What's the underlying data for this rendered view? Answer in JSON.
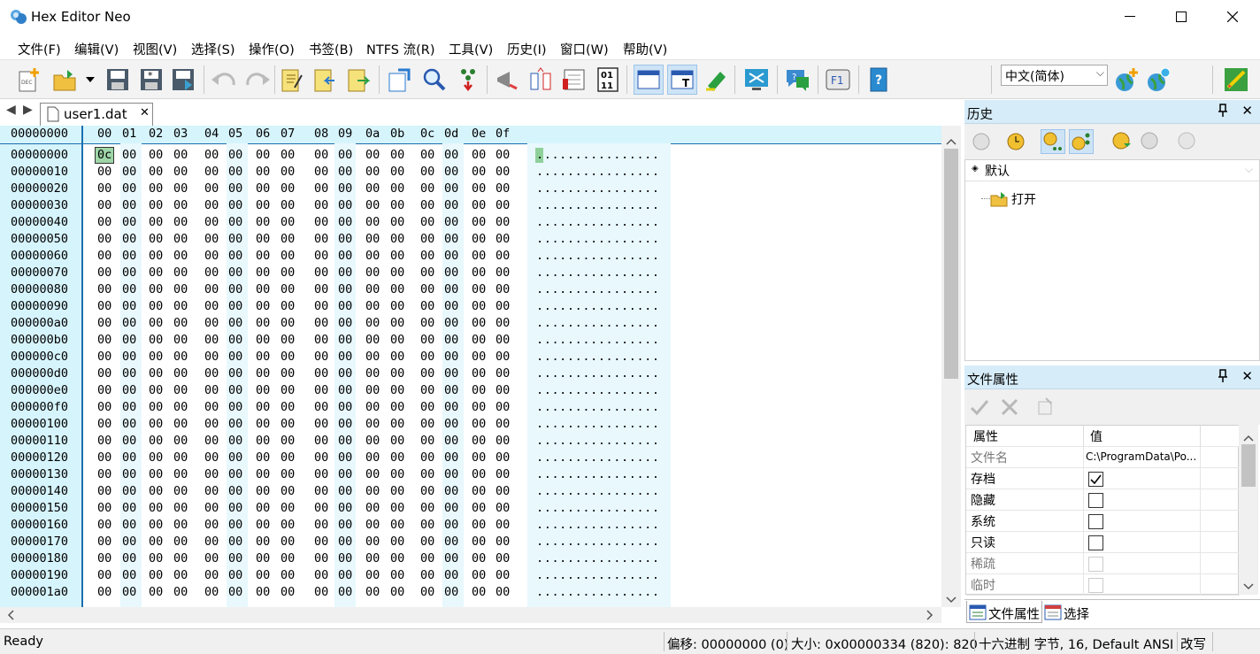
{
  "window": {
    "title": "Hex Editor Neo",
    "minimize": "—",
    "maximize": "☐",
    "close": "✕"
  },
  "menu": [
    "文件(F)",
    "编辑(V)",
    "视图(V)",
    "选择(S)",
    "操作(O)",
    "书签(B)",
    "NTFS 流(R)",
    "工具(V)",
    "历史(I)",
    "窗口(W)",
    "帮助(V)"
  ],
  "toolbar": {
    "language": "中文(简体)"
  },
  "tabs": {
    "nav_back": "◀",
    "nav_fwd": "▶",
    "file": "user1.dat",
    "close": "✕"
  },
  "hex": {
    "header_offset": "00000000",
    "columns": [
      "00",
      "01",
      "02",
      "03",
      "04",
      "05",
      "06",
      "07",
      "08",
      "09",
      "0a",
      "0b",
      "0c",
      "0d",
      "0e",
      "0f"
    ],
    "selected_byte": "0c",
    "row_offsets": [
      "00000000",
      "00000010",
      "00000020",
      "00000030",
      "00000040",
      "00000050",
      "00000060",
      "00000070",
      "00000080",
      "00000090",
      "000000a0",
      "000000b0",
      "000000c0",
      "000000d0",
      "000000e0",
      "000000f0",
      "00000100",
      "00000110",
      "00000120",
      "00000130",
      "00000140",
      "00000150",
      "00000160",
      "00000170",
      "00000180",
      "00000190",
      "000001a0"
    ],
    "byte_value": "00",
    "ascii_row": "................"
  },
  "history": {
    "title": "历史",
    "pin": "📌",
    "close": "✕",
    "root": "默认",
    "item": "打开"
  },
  "props": {
    "title": "文件属性",
    "pin": "📌",
    "close": "✕",
    "col_key": "属性",
    "col_val": "值",
    "rows": [
      {
        "key": "文件名",
        "value": "C:\\ProgramData\\Po...",
        "type": "text"
      },
      {
        "key": "存档",
        "checked": true,
        "type": "check"
      },
      {
        "key": "隐藏",
        "checked": false,
        "type": "check"
      },
      {
        "key": "系统",
        "checked": false,
        "type": "check"
      },
      {
        "key": "只读",
        "checked": false,
        "type": "check"
      },
      {
        "key": "稀疏",
        "checked": false,
        "type": "check-disabled"
      },
      {
        "key": "临时",
        "checked": false,
        "type": "check-disabled"
      }
    ]
  },
  "bottom_tabs": [
    "文件属性",
    "选择"
  ],
  "status": {
    "ready": "Ready",
    "offset": "偏移: 00000000 (0)",
    "size": "大小: 0x00000334 (820): 820",
    "mode": "十六进制 字节, 16, Default ANSI",
    "edit": "改写"
  }
}
